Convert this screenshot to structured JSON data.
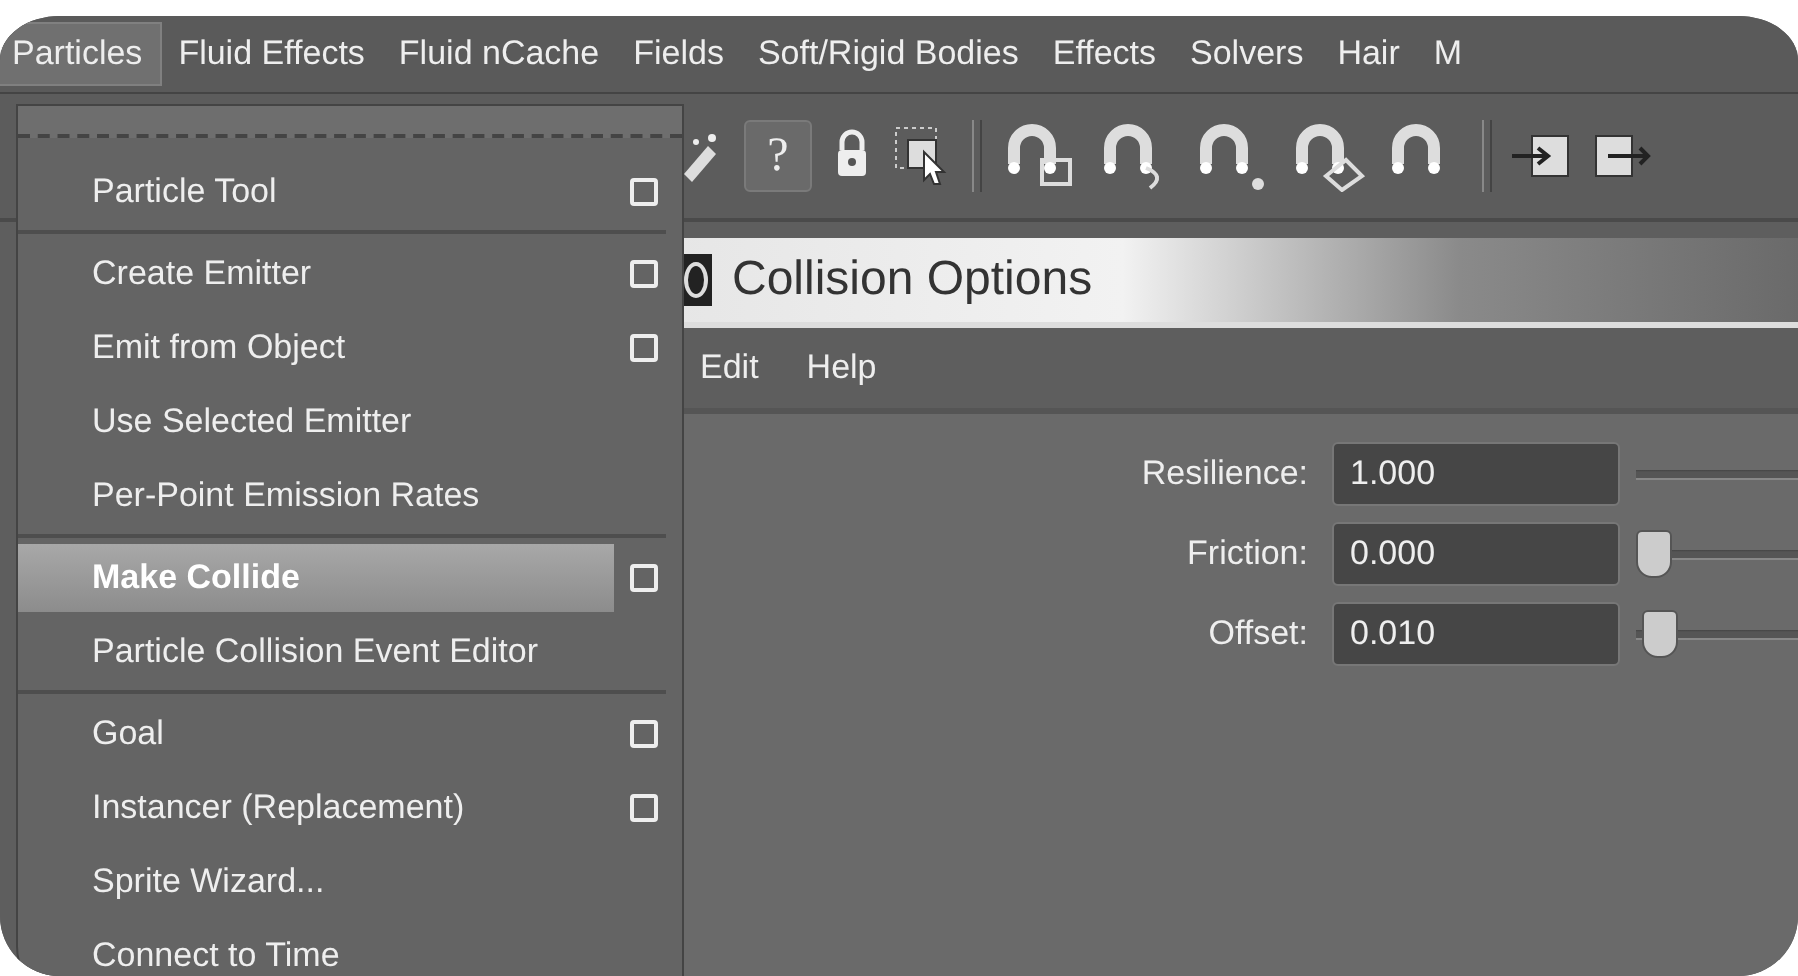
{
  "menubar": [
    {
      "label": "Particles",
      "selected": true
    },
    {
      "label": "Fluid Effects",
      "selected": false
    },
    {
      "label": "Fluid nCache",
      "selected": false
    },
    {
      "label": "Fields",
      "selected": false
    },
    {
      "label": "Soft/Rigid Bodies",
      "selected": false
    },
    {
      "label": "Effects",
      "selected": false
    },
    {
      "label": "Solvers",
      "selected": false
    },
    {
      "label": "Hair",
      "selected": false
    },
    {
      "label": "M",
      "selected": false
    }
  ],
  "toolbar": {
    "help_glyph": "?"
  },
  "menu": {
    "items": [
      {
        "kind": "item",
        "label": "Particle Tool",
        "option_box": true,
        "selected": false
      },
      {
        "kind": "separator"
      },
      {
        "kind": "item",
        "label": "Create Emitter",
        "option_box": true,
        "selected": false
      },
      {
        "kind": "item",
        "label": "Emit from Object",
        "option_box": true,
        "selected": false
      },
      {
        "kind": "item",
        "label": "Use Selected Emitter",
        "option_box": false,
        "selected": false
      },
      {
        "kind": "item",
        "label": "Per-Point Emission Rates",
        "option_box": false,
        "selected": false
      },
      {
        "kind": "separator"
      },
      {
        "kind": "item",
        "label": "Make Collide",
        "option_box": true,
        "selected": true
      },
      {
        "kind": "item",
        "label": "Particle Collision Event Editor",
        "option_box": false,
        "selected": false
      },
      {
        "kind": "separator"
      },
      {
        "kind": "item",
        "label": "Goal",
        "option_box": true,
        "selected": false
      },
      {
        "kind": "item",
        "label": "Instancer (Replacement)",
        "option_box": true,
        "selected": false
      },
      {
        "kind": "item",
        "label": "Sprite Wizard...",
        "option_box": false,
        "selected": false
      },
      {
        "kind": "item",
        "label": "Connect to Time",
        "option_box": false,
        "selected": false
      }
    ]
  },
  "dialog": {
    "title": "Collision Options",
    "menus": [
      "Edit",
      "Help"
    ],
    "fields": [
      {
        "label": "Resilience:",
        "value": "1.000"
      },
      {
        "label": "Friction:",
        "value": "0.000",
        "level": 0
      },
      {
        "label": "Offset:",
        "value": "0.010",
        "level": 0.01
      }
    ]
  }
}
